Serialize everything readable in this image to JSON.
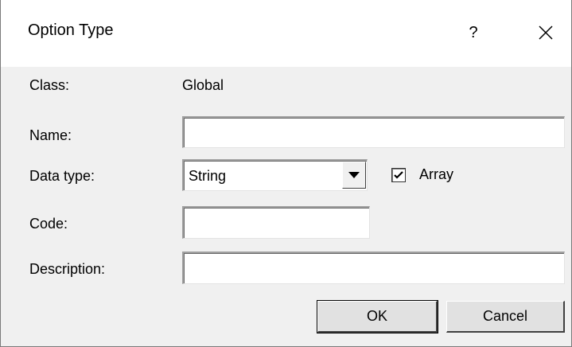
{
  "dialog": {
    "title": "Option Type",
    "help_label": "?",
    "close_icon": "close-icon"
  },
  "form": {
    "class_label": "Class:",
    "class_value": "Global",
    "name_label": "Name:",
    "name_value": "",
    "data_type_label": "Data type:",
    "data_type_value": "String",
    "array_label": "Array",
    "array_checked": true,
    "code_label": "Code:",
    "code_value": "",
    "description_label": "Description:",
    "description_value": ""
  },
  "buttons": {
    "ok_label": "OK",
    "cancel_label": "Cancel"
  }
}
